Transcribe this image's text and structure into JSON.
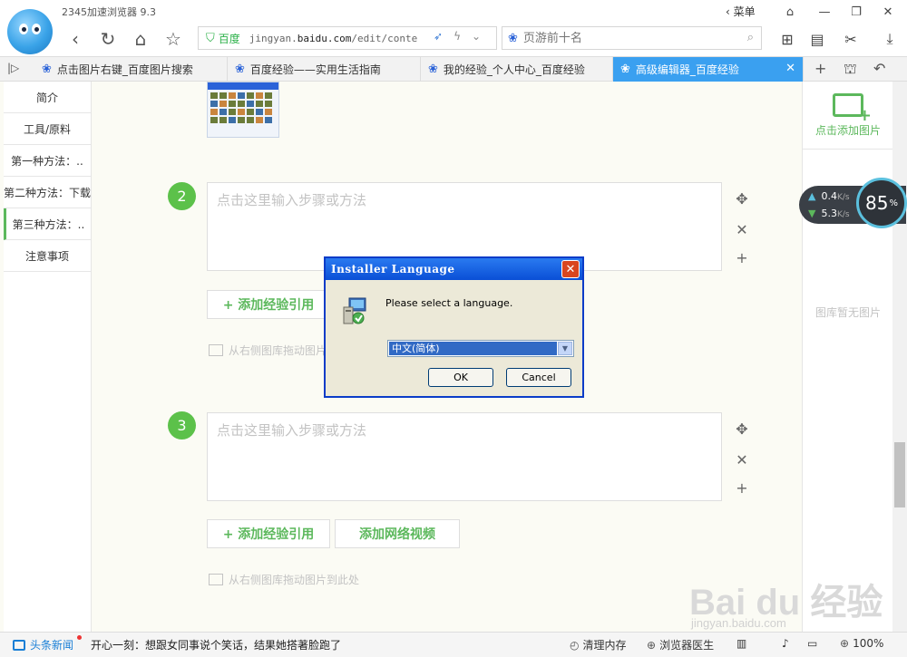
{
  "window": {
    "title": "2345加速浏览器 9.3",
    "menu_label": "菜单"
  },
  "toolbar": {
    "address_site": "百度",
    "address_url_prefix": "jingyan.",
    "address_url_domain": "baidu.com",
    "address_url_suffix": "/edit/conte",
    "search_placeholder": "页游前十名"
  },
  "tabs": [
    {
      "label": "点击图片右键_百度图片搜索",
      "active": false
    },
    {
      "label": "百度经验——实用生活指南",
      "active": false
    },
    {
      "label": "我的经验_个人中心_百度经验",
      "active": false
    },
    {
      "label": "高级编辑器_百度经验",
      "active": true
    }
  ],
  "left_nav": {
    "items": [
      {
        "label": "简介",
        "active": false
      },
      {
        "label": "工具/原料",
        "active": false
      },
      {
        "label": "第一种方法：..",
        "active": false
      },
      {
        "label": "第二种方法：下载",
        "active": false
      },
      {
        "label": "第三种方法：..",
        "active": true
      },
      {
        "label": "注意事项",
        "active": false
      }
    ]
  },
  "steps": [
    {
      "number": "2",
      "placeholder": "点击这里输入步骤或方法"
    },
    {
      "number": "3",
      "placeholder": "点击这里输入步骤或方法"
    }
  ],
  "actions": {
    "add_citation": "+ 添加经验引用",
    "add_video": "添加网络视频",
    "drag_hint": "从右侧图库拖动图片到此处"
  },
  "right_panel": {
    "add_pic_label": "点击添加图片",
    "no_pic_label": "图库暂无图片"
  },
  "speed_widget": {
    "upload": "0.4",
    "download": "5.3",
    "unit": "K/s",
    "memory_value": "85",
    "memory_unit": "%"
  },
  "dialog": {
    "title": "Installer Language",
    "message": "Please select a language.",
    "selected_language": "中文(简体)",
    "ok_label": "OK",
    "cancel_label": "Cancel"
  },
  "watermark": {
    "main": "Bai du 经验",
    "sub": "jingyan.baidu.com"
  },
  "statusbar": {
    "news_label": "头条新闻",
    "news_text": "开心一刻：想跟女同事说个笑话，结果她搭著脸跑了",
    "clean_memory": "清理内存",
    "doctor": "浏览器医生",
    "zoom": "100%"
  },
  "colors": {
    "accent_green": "#5cb85c",
    "tab_active": "#3aa0f0",
    "dialog_title": "#0a4fd6"
  }
}
